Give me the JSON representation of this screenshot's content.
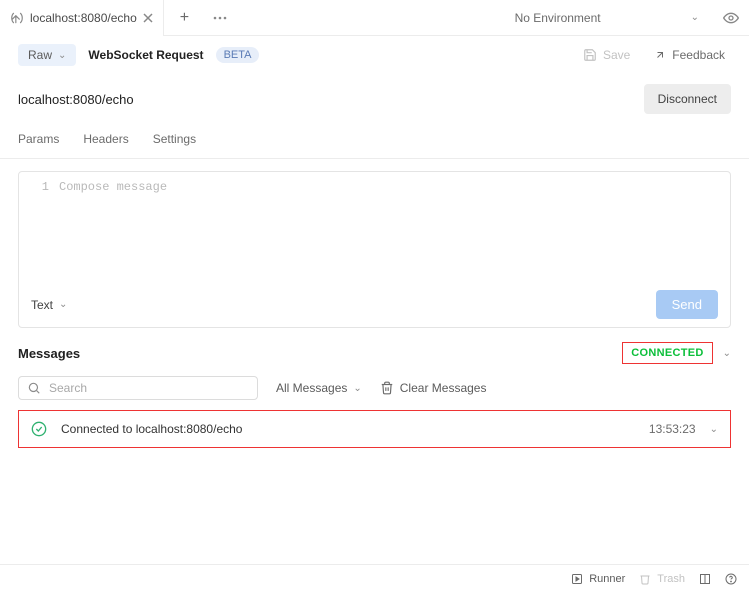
{
  "tab": {
    "title": "localhost:8080/echo"
  },
  "environment": {
    "label": "No Environment"
  },
  "request": {
    "raw_label": "Raw",
    "title": "WebSocket Request",
    "beta": "BETA",
    "save": "Save",
    "feedback": "Feedback",
    "url": "localhost:8080/echo",
    "disconnect": "Disconnect"
  },
  "subtabs": {
    "params": "Params",
    "headers": "Headers",
    "settings": "Settings"
  },
  "composer": {
    "line_no": "1",
    "placeholder": "Compose message",
    "format": "Text",
    "send": "Send"
  },
  "messages": {
    "title": "Messages",
    "status": "CONNECTED",
    "search_placeholder": "Search",
    "filter_label": "All Messages",
    "clear_label": "Clear Messages",
    "row": {
      "text": "Connected to localhost:8080/echo",
      "time": "13:53:23"
    }
  },
  "footer": {
    "runner": "Runner",
    "trash": "Trash"
  }
}
